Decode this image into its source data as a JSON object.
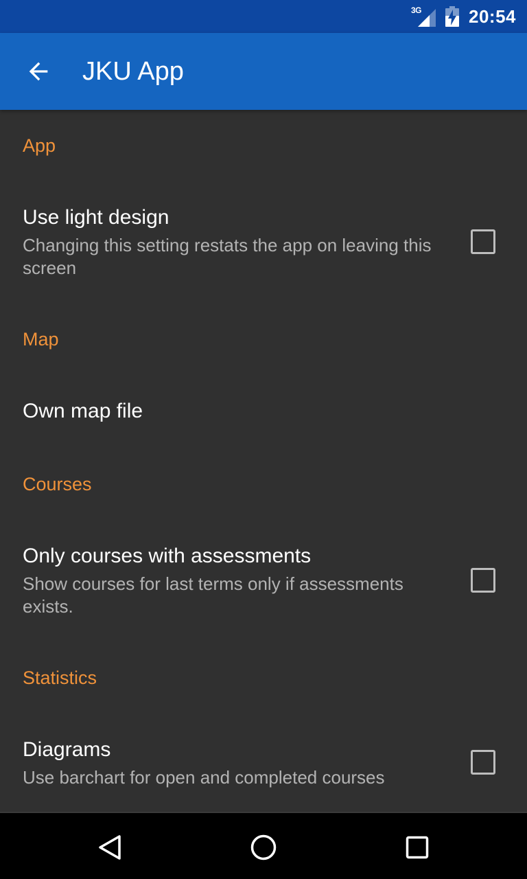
{
  "status_bar": {
    "network": "3G",
    "time": "20:54",
    "signal_icon": "signal-icon",
    "battery_icon": "battery-charging-icon"
  },
  "app_bar": {
    "title": "JKU App",
    "back_icon": "arrow-back-icon"
  },
  "sections": [
    {
      "category": "App",
      "preferences": [
        {
          "title": "Use light design",
          "summary": "Changing this setting restats the app on leaving this screen",
          "checked": false
        }
      ]
    },
    {
      "category": "Map",
      "preferences": [
        {
          "title": "Own map file"
        }
      ]
    },
    {
      "category": "Courses",
      "preferences": [
        {
          "title": "Only courses with assessments",
          "summary": "Show courses for last terms only if assessments exists.",
          "checked": false
        }
      ]
    },
    {
      "category": "Statistics",
      "preferences": [
        {
          "title": "Diagrams",
          "summary": "Use barchart for open and completed courses",
          "checked": false
        }
      ]
    }
  ],
  "nav_bar": {
    "back_icon": "nav-back-icon",
    "home_icon": "nav-home-icon",
    "recents_icon": "nav-recents-icon"
  },
  "colors": {
    "status_bar": "#0d47a1",
    "app_bar": "#1565c0",
    "background": "#303030",
    "category_accent": "#f0923a",
    "summary_text": "#b3b3b3"
  }
}
